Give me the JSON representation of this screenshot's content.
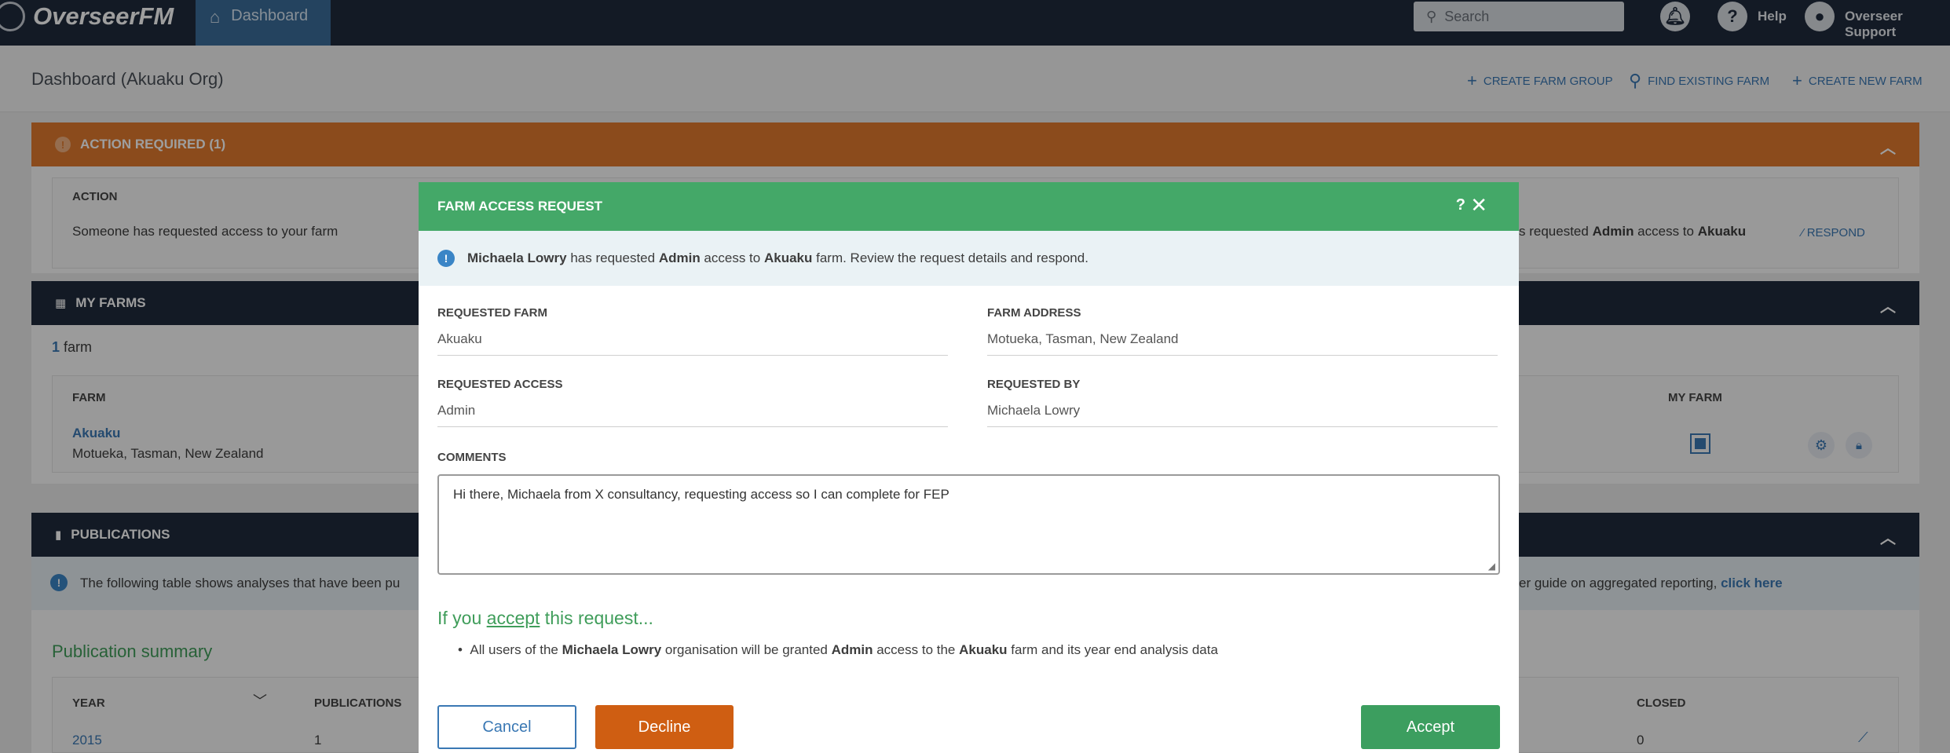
{
  "app": {
    "name": "OverseerFM"
  },
  "nav": {
    "dashboard": "Dashboard",
    "search_placeholder": "Search",
    "help": "Help",
    "user": "Overseer Support"
  },
  "header": {
    "title": "Dashboard (Akuaku Org)",
    "actions": [
      "CREATE FARM GROUP",
      "FIND EXISTING FARM",
      "CREATE NEW FARM"
    ]
  },
  "action_required": {
    "title": "ACTION REQUIRED (1)",
    "column_action": "ACTION",
    "row_text": "Someone has requested access to your farm",
    "row_detail_pre": "s requested ",
    "row_detail_access": "Admin",
    "row_detail_mid": " access to ",
    "row_detail_farm": "Akuaku",
    "respond": "RESPOND"
  },
  "my_farms": {
    "title": "MY FARMS",
    "count_num": "1",
    "count_label": "farm",
    "col_farm": "FARM",
    "col_my_farm": "MY FARM",
    "farm_name": "Akuaku",
    "farm_address": "Motueka, Tasman, New Zealand"
  },
  "publications": {
    "title": "PUBLICATIONS",
    "info_left": "The following table shows analyses that have been pu",
    "info_right": "er guide on aggregated reporting,",
    "info_link": "click here",
    "summary_title": "Publication summary",
    "col_year": "YEAR",
    "col_publications": "PUBLICATIONS",
    "col_closed": "CLOSED",
    "row_year": "2015",
    "row_publications": "1",
    "row_closed": "0"
  },
  "modal": {
    "title": "FARM ACCESS REQUEST",
    "help": "?",
    "close": "✕",
    "info_user": "Michaela Lowry",
    "info_mid1": " has requested ",
    "info_access": "Admin",
    "info_mid2": " access to ",
    "info_farm": "Akuaku",
    "info_end": " farm. Review the request details and respond.",
    "requested_farm_label": "REQUESTED FARM",
    "requested_farm": "Akuaku",
    "farm_address_label": "FARM ADDRESS",
    "farm_address": "Motueka, Tasman, New Zealand",
    "requested_access_label": "REQUESTED ACCESS",
    "requested_access": "Admin",
    "requested_by_label": "REQUESTED BY",
    "requested_by": "Michaela Lowry",
    "comments_label": "COMMENTS",
    "comments": "Hi there, Michaela from X consultancy, requesting access so I can complete for FEP",
    "accept_pre": "If you ",
    "accept_word": "accept",
    "accept_post": " this request...",
    "bullet_pre": "All users of the ",
    "bullet_org": "Michaela Lowry",
    "bullet_mid1": " organisation will be granted ",
    "bullet_access": "Admin",
    "bullet_mid2": " access to the ",
    "bullet_farm": "Akuaku",
    "bullet_end": " farm and its year end analysis data",
    "cancel": "Cancel",
    "decline": "Decline",
    "accept": "Accept"
  },
  "colors": {
    "topbar": "#1f2a3c",
    "action_bar": "#e07a2e",
    "modal_header": "#44a868",
    "accept_button": "#3c9e5f",
    "decline_button": "#cf5e12",
    "link": "#3a78b4"
  }
}
